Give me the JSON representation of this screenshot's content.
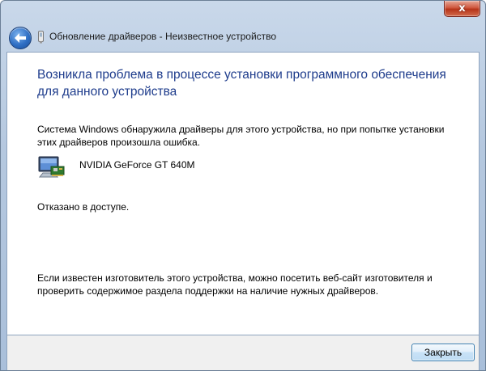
{
  "window": {
    "close_glyph": "x"
  },
  "nav": {
    "title": "Обновление драйверов - Неизвестное устройство",
    "back_icon": "back-arrow-icon"
  },
  "content": {
    "heading": "Возникла проблема в процессе установки программного обеспечения для данного устройства",
    "description": "Система Windows обнаружила драйверы для этого устройства, но при попытке установки этих драйверов произошла ошибка.",
    "device_name": "NVIDIA GeForce GT 640M",
    "error_message": "Отказано в доступе.",
    "hint": "Если известен изготовитель этого устройства, можно посетить веб-сайт изготовителя и проверить содержимое раздела поддержки на наличие нужных драйверов."
  },
  "footer": {
    "close_label": "Закрыть"
  },
  "colors": {
    "heading": "#1e3c8c",
    "accent_button_border": "#3c7fb1",
    "close_red": "#c0401f"
  }
}
